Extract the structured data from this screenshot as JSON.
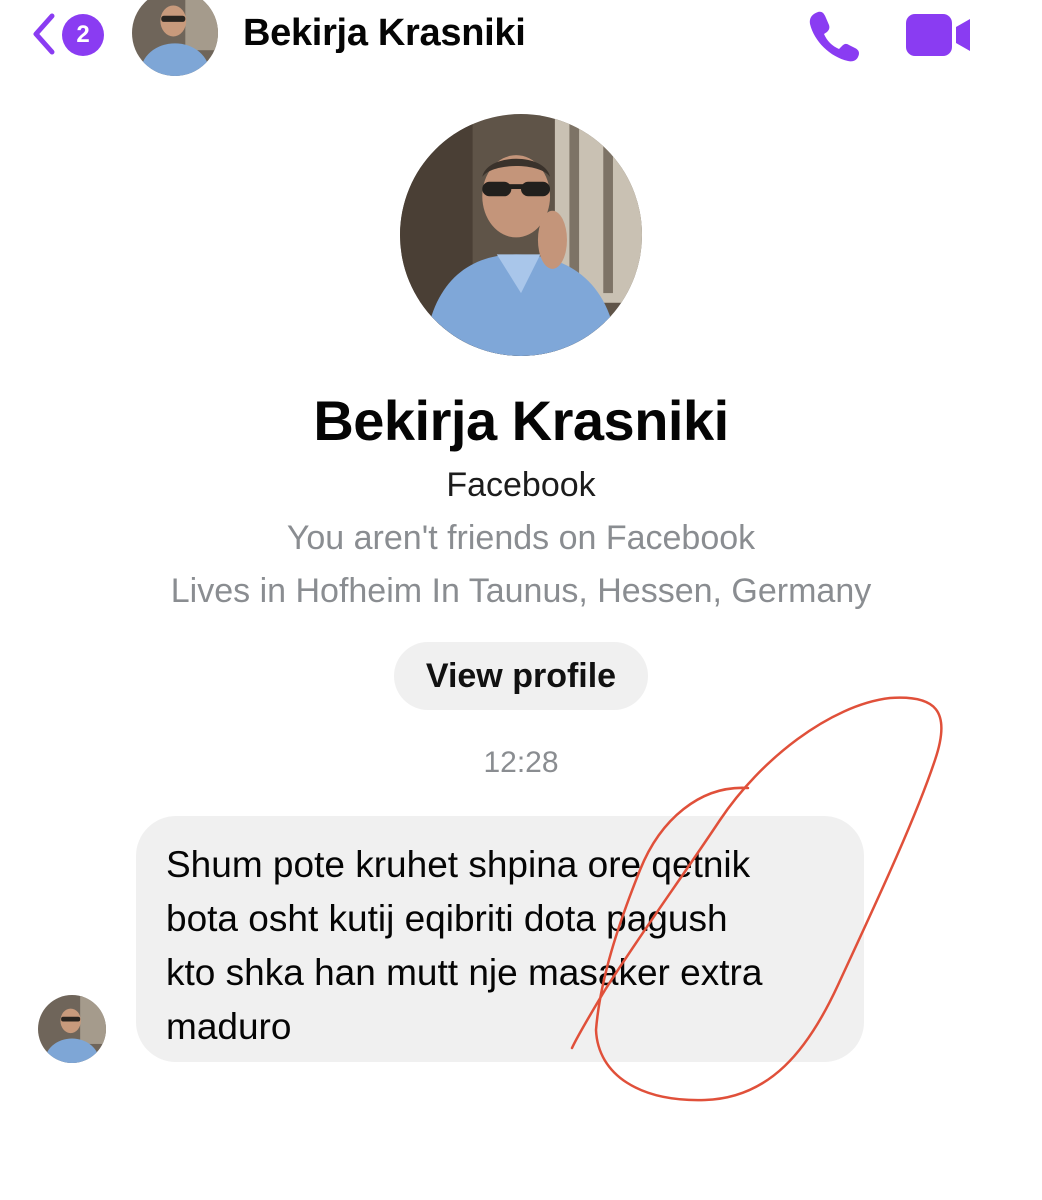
{
  "header": {
    "back_badge": "2",
    "contact_name": "Bekirja Krasniki",
    "icons": {
      "back": "chevron-left-icon",
      "call": "phone-icon",
      "video": "video-camera-icon"
    },
    "accent_color": "#8a3cf2"
  },
  "profile": {
    "name": "Bekirja Krasniki",
    "source": "Facebook",
    "friend_status": "You aren't friends on Facebook",
    "location": "Lives in Hofheim In Taunus, Hessen, Germany",
    "view_profile_label": "View profile"
  },
  "conversation": {
    "timestamp": "12:28",
    "messages": [
      {
        "text": "Shum pote kruhet shpina ore qetnik\nbota osht kutij eqibriti dota pagush\nkto shka han mutt nje masaker extra\nmaduro"
      }
    ]
  },
  "annotation_color": "#e0503a"
}
